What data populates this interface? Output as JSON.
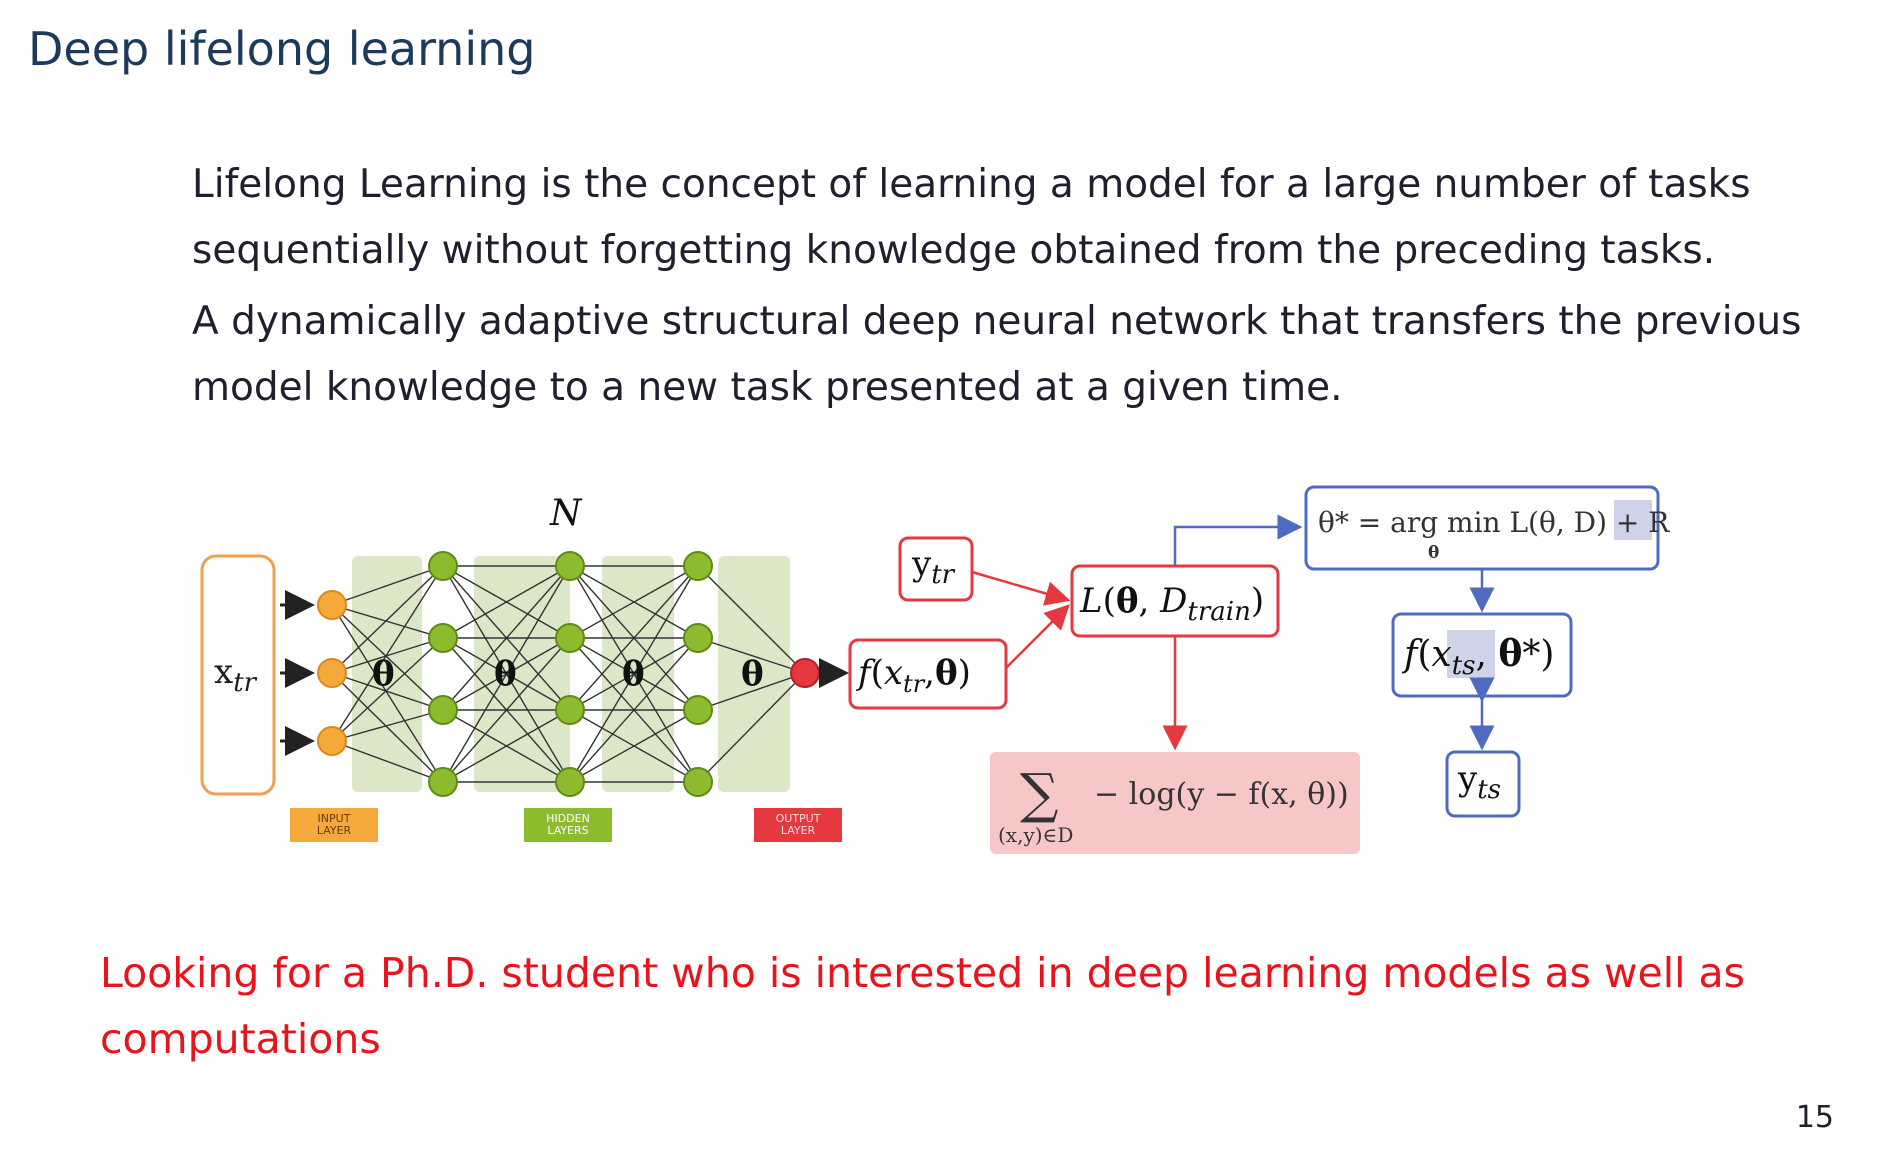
{
  "slide": {
    "title": "Deep lifelong learning",
    "paragraph1": [
      "Lifelong Learning is the concept of learning a model for a large number of tasks",
      "sequentially without forgetting knowledge obtained from the preceding tasks."
    ],
    "paragraph2": [
      "A dynamically adaptive structural deep neural network that transfers the previous",
      "model knowledge to a new task presented at a given time."
    ],
    "cta": [
      "Looking for a Ph.D. student who is interested in deep learning models as well as",
      "computations"
    ],
    "page_number": "15"
  },
  "diagram": {
    "n_label": "N",
    "input_label": "x",
    "input_sub": "tr",
    "theta": "θ",
    "layer_labels": {
      "input": [
        "INPUT",
        "LAYER"
      ],
      "hidden": [
        "HIDDEN",
        "LAYERS"
      ],
      "output": [
        "OUTPUT",
        "LAYER"
      ]
    },
    "y_tr": {
      "main": "y",
      "sub": "tr"
    },
    "f_xtr": "f(x_tr, θ)",
    "loss": "L(θ, D_train)",
    "argmin": "θ* = arg min L(θ, D) + R",
    "argmin_under": "θ",
    "f_xts": "f(x_ts, θ*)",
    "y_ts": {
      "main": "y",
      "sub": "ts"
    },
    "sum_expr": "− log(y − f(x, θ))",
    "sum_under": "(x,y)∈D",
    "colors": {
      "orange": "#f4a93a",
      "green": "#8dbb2e",
      "green_panel": "#dbe7c7",
      "red": "#e6383f",
      "blue": "#4f6bbf",
      "pink": "#f7c6c6"
    }
  }
}
